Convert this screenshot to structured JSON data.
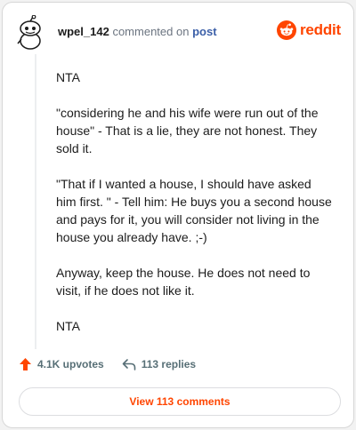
{
  "comment": {
    "username": "wpel_142",
    "action": "commented on",
    "target": "post",
    "paragraphs": [
      "NTA",
      "\"considering he and his wife were run out of the house\" - That is a lie, they are not honest. They sold it.",
      "\"That if I wanted a house, I should have asked him first. \" - Tell him: He buys you a second house and pays for it, you will consider not living in the house you already have. ;-)",
      "Anyway, keep the house. He does not need to visit, if he does not like it.",
      "NTA"
    ]
  },
  "brand": {
    "name": "reddit",
    "icon": "reddit-alien-icon",
    "color": "#ff4500"
  },
  "stats": {
    "upvotes": "4.1K upvotes",
    "replies": "113 replies",
    "upvote_icon": "upvote-arrow-icon",
    "reply_icon": "reply-arrow-icon",
    "upvote_color": "#ff4500"
  },
  "cta": {
    "label": "View 113 comments"
  }
}
